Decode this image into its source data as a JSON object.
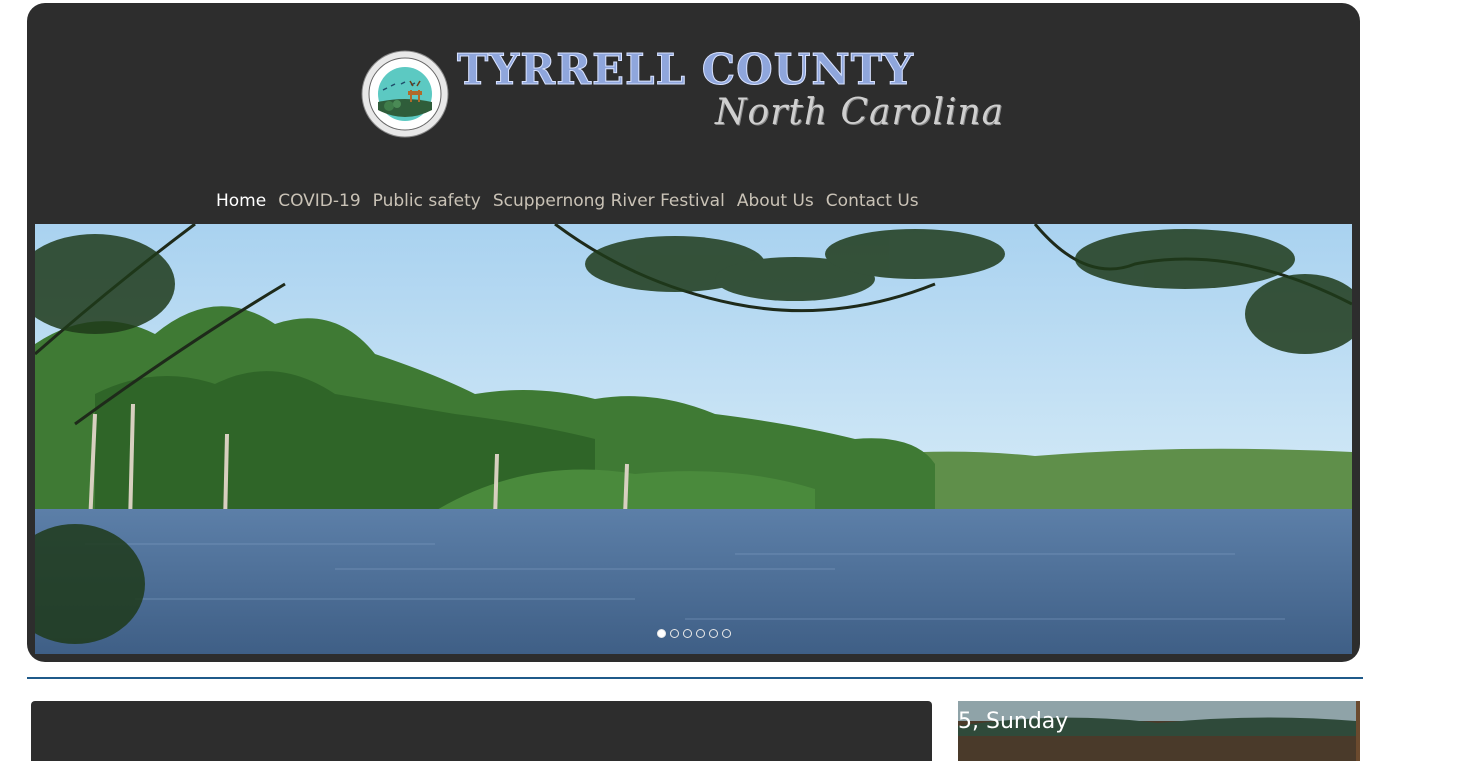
{
  "header": {
    "seal_lettering": "TYRRELL COUNTY NORTH 1729 CAROLINA",
    "title_main": "TYRRELL COUNTY",
    "title_sub": "North Carolina"
  },
  "nav": {
    "items": [
      {
        "label": "Home",
        "active": true
      },
      {
        "label": "COVID-19",
        "active": false
      },
      {
        "label": "Public safety",
        "active": false
      },
      {
        "label": "Scuppernong River Festival",
        "active": false
      },
      {
        "label": "About Us",
        "active": false
      },
      {
        "label": "Contact Us",
        "active": false
      }
    ]
  },
  "slideshow": {
    "slide_count": 6,
    "active_index": 0
  },
  "sidebar": {
    "date_text": "5, Sunday"
  },
  "colors": {
    "header_bg": "#2d2d2d",
    "divider": "#1f5a8a",
    "nav_text": "#c9c2b6",
    "nav_active": "#ffffff"
  },
  "icons": [
    "county-seal-icon",
    "slide-dot-icon"
  ]
}
